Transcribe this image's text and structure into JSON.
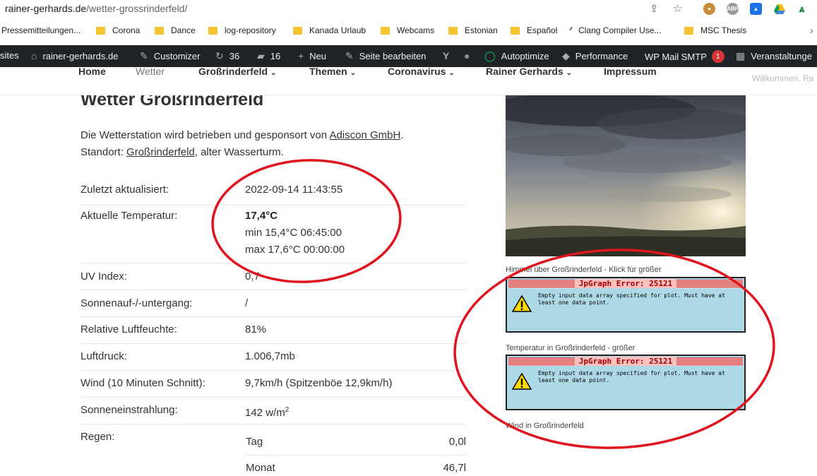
{
  "browser": {
    "url_domain": "rainer-gerhards.de",
    "url_path": "/wetter-grossrinderfeld/",
    "bookmarks": [
      {
        "label": "Pressemitteilungen..."
      },
      {
        "label": "Corona"
      },
      {
        "label": "Dance"
      },
      {
        "label": "log-repository"
      },
      {
        "label": "Kanada Urlaub"
      },
      {
        "label": "Webcams"
      },
      {
        "label": "Estonian"
      },
      {
        "label": "Español"
      },
      {
        "label": "Clang Compiler Use..."
      },
      {
        "label": "MSC Thesis"
      }
    ],
    "extension_abp": "ABP"
  },
  "adminbar": {
    "sites": "sites",
    "site_name": "rainer-gerhards.de",
    "customizer": "Customizer",
    "updates_count": "36",
    "comments_count": "16",
    "new": "Neu",
    "edit_page": "Seite bearbeiten",
    "autoptimize": "Autoptimize",
    "performance": "Performance",
    "wp_mail_smtp": "WP Mail SMTP",
    "wp_mail_badge": "1",
    "events": "Veranstaltunge"
  },
  "nav": {
    "items": [
      {
        "label": "Home"
      },
      {
        "label": "Wetter"
      },
      {
        "label": "Großrinderfeld"
      },
      {
        "label": "Themen"
      },
      {
        "label": "Coronavirus"
      },
      {
        "label": "Rainer Gerhards"
      },
      {
        "label": "Impressum"
      }
    ],
    "welcome": "Willkommen, Ra"
  },
  "page": {
    "title": "Wetter Großrinderfeld",
    "intro_before": "Die Wetterstation wird betrieben und gesponsort von ",
    "intro_link1": "Adiscon GmbH",
    "intro_after1": ".",
    "intro_location": "Standort: ",
    "intro_link2": "Großrinderfeld",
    "intro_after2": ", alter Wasserturm."
  },
  "weather": {
    "updated_label": "Zuletzt aktualisiert:",
    "updated_value": "2022-09-14 11:43:55",
    "temp_label": "Aktuelle Temperatur:",
    "temp_current": "17,4°C",
    "temp_min": "min 15,4°C 06:45:00",
    "temp_max": "max 17,6°C 00:00:00",
    "uv_label": "UV Index:",
    "uv_value": "0,7",
    "sun_label": "Sonnenauf-/-untergang:",
    "sun_value": "/",
    "humidity_label": "Relative Luftfeuchte:",
    "humidity_value": "81%",
    "pressure_label": "Luftdruck:",
    "pressure_value": "1.006,7mb",
    "wind_label": "Wind (10 Minuten Schnitt):",
    "wind_value": "9,7km/h (Spitzenböe 12,9km/h)",
    "radiation_label": "Sonneneinstrahlung:",
    "radiation_value": "142 w/m",
    "radiation_sup": "2",
    "rain_label": "Regen:",
    "rain_day_label": "Tag",
    "rain_day_value": "0,0l",
    "rain_month_label": "Monat",
    "rain_month_value": "46,7l"
  },
  "sidebar": {
    "webcam_caption": "Himmel über Großrinderfeld - Klick für größer",
    "temp_caption": "Temperatur in Großrinderfeld - größer",
    "wind_caption": "Wind in Großrinderfeld",
    "jpgraph_title": "JpGraph Error: 25121",
    "jpgraph_message": "Empty input data array specified for plot. Must have at least one data point."
  },
  "colors": {
    "admin_bar": "#1d2327",
    "annotation": "#e0141e",
    "jpgraph_bg": "#add8e6",
    "folder": "#f4c430"
  }
}
